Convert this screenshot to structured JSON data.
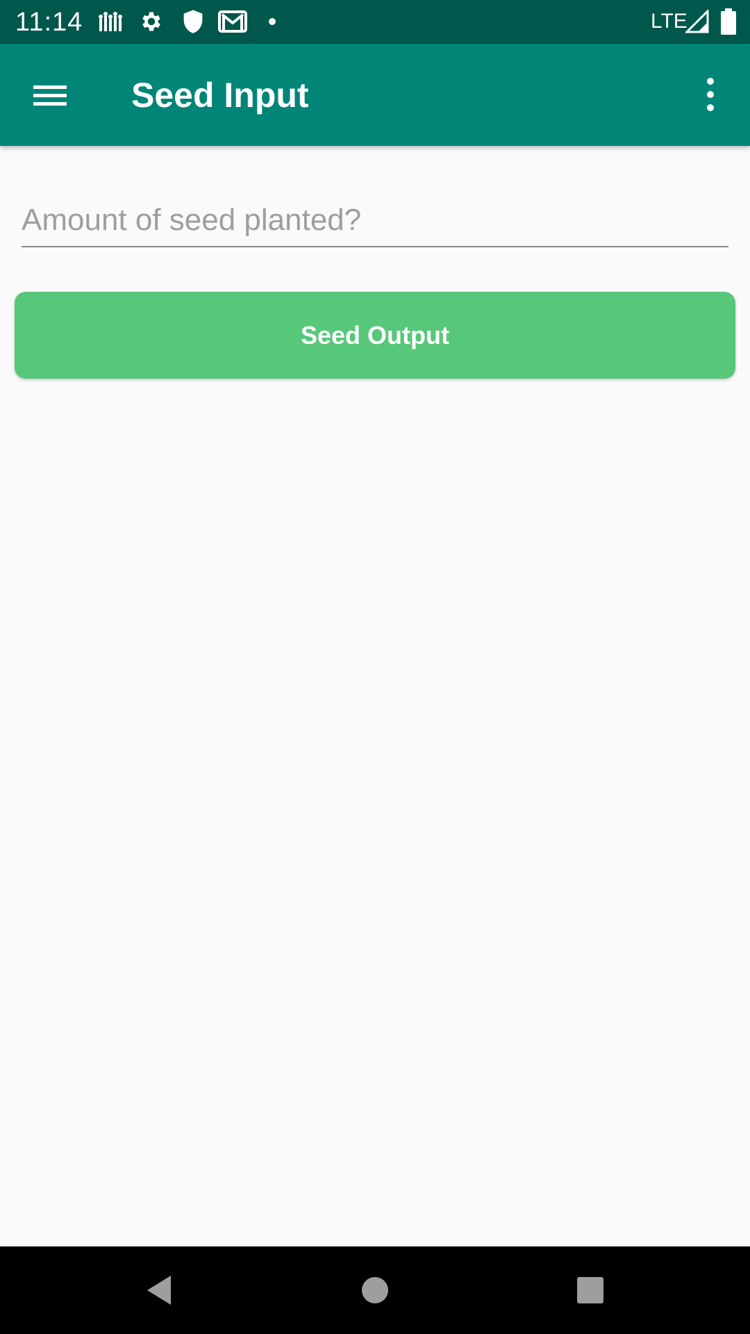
{
  "status_bar": {
    "time": "11:14",
    "network": "LTE",
    "icons": [
      "farm-app-icon",
      "settings-icon",
      "shield-icon",
      "gmail-icon",
      "dot-icon",
      "signal-icon",
      "battery-icon"
    ]
  },
  "app_bar": {
    "title": "Seed Input",
    "menu_icon": "hamburger-menu-icon",
    "overflow_icon": "more-vert-icon"
  },
  "form": {
    "seed_input_value": "",
    "seed_input_placeholder": "Amount of seed planted?",
    "submit_label": "Seed Output"
  },
  "nav_bar": {
    "buttons": [
      "back-icon",
      "home-icon",
      "recents-icon"
    ]
  },
  "colors": {
    "status_bar": "#00574b",
    "app_bar": "#008577",
    "button": "#57c77a",
    "background": "#fafafa"
  }
}
